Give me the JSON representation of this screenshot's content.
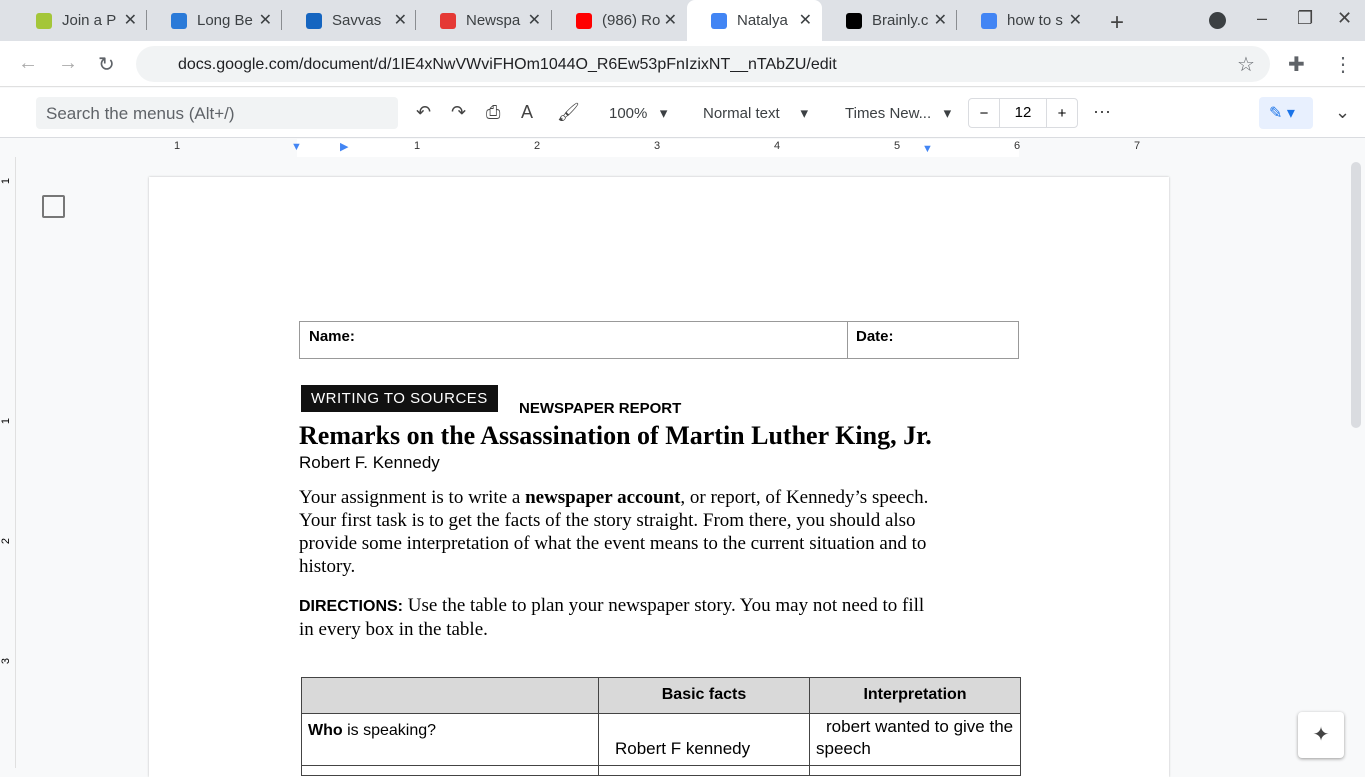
{
  "tabs": [
    {
      "title": "Join a P",
      "color": "#a4c639"
    },
    {
      "title": "Long Be",
      "color": "#2a7ad8"
    },
    {
      "title": "Savvas",
      "color": "#1565c0"
    },
    {
      "title": "Newspa",
      "color": "#e53935"
    },
    {
      "title": "(986) Ro",
      "color": "#ff0000"
    },
    {
      "title": "Natalya",
      "color": "#4285f4",
      "active": true
    },
    {
      "title": "Brainly.c",
      "color": "#000000"
    },
    {
      "title": "how to s",
      "color": "#4285f4"
    }
  ],
  "address": {
    "url": "docs.google.com/document/d/1IE4xNwVWviFHOm1044O_R6Ew53pFnIzixNT__nTAbZU/edit"
  },
  "toolbar": {
    "search_placeholder": "Search the menus (Alt+/)",
    "zoom": "100%",
    "style": "Normal text",
    "font": "Times New...",
    "font_size": "12"
  },
  "ruler": [
    "1",
    "1",
    "2",
    "3",
    "4",
    "5",
    "6",
    "7"
  ],
  "vruler": [
    "1",
    "1",
    "2",
    "3"
  ],
  "doc": {
    "name_label": "Name:",
    "date_label": "Date:",
    "badge": "WRITING TO SOURCES",
    "badge_sub": "NEWSPAPER REPORT",
    "title": "Remarks on the Assassination of Martin Luther King, Jr.",
    "author": "Robert F. Kennedy",
    "p1_a": "Your assignment is to write a ",
    "p1_b": "newspaper account",
    "p1_c": ", or report, of Kennedy’s speech. Your first task is to get the facts of the story straight. From there, you should also provide some interpretation of what the event means to the current situation and to history.",
    "dir_label": "DIRECTIONS:",
    "dir_text": " Use the table to plan your newspaper story. You may not need to fill in every box in the table.",
    "table": {
      "headers": [
        "",
        "Basic facts",
        "Interpretation"
      ],
      "row1_bold": "Who",
      "row1_rest": " is speaking?",
      "row1_fact": "Robert F kennedy",
      "row1_interp": "robert wanted to give the speech"
    }
  }
}
